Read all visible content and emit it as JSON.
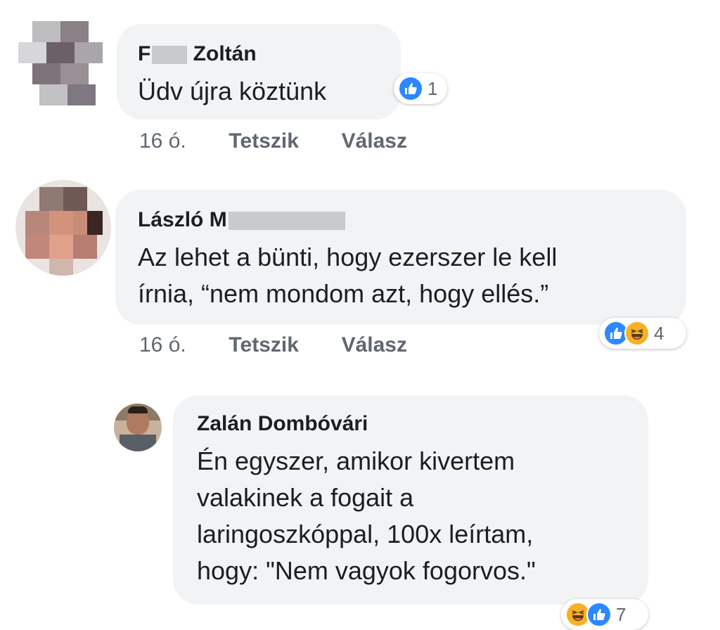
{
  "comments": [
    {
      "author_first": "F",
      "author_last": "Zoltán",
      "text_lines": [
        "Üdv újra köztünk"
      ],
      "time": "16 ó.",
      "like_label": "Tetszik",
      "reply_label": "Válasz",
      "reaction_count": "1",
      "reactions": [
        "like-icon"
      ]
    },
    {
      "author_first": "László M",
      "author_last": "",
      "text_lines": [
        "Az lehet a bünti, hogy ezerszer le kell",
        "írnia, “nem mondom azt, hogy ellés.”"
      ],
      "time": "16 ó.",
      "like_label": "Tetszik",
      "reply_label": "Válasz",
      "reaction_count": "4",
      "reactions": [
        "like-icon",
        "haha-icon"
      ]
    },
    {
      "author_first": "Zalán Dombóvári",
      "author_last": "",
      "text_lines": [
        "Én egyszer, amikor kivertem",
        "valakinek a fogait a",
        "laringoszkóppal, 100x leírtam,",
        "hogy: \"Nem vagyok fogorvos.\""
      ],
      "reaction_count": "7",
      "reactions": [
        "haha-icon",
        "like-icon"
      ]
    }
  ],
  "colors": {
    "bubble": "#f2f3f5",
    "like_blue": "#2d88ff",
    "haha_yellow": "#f7b125",
    "meta_gray": "#606770"
  }
}
